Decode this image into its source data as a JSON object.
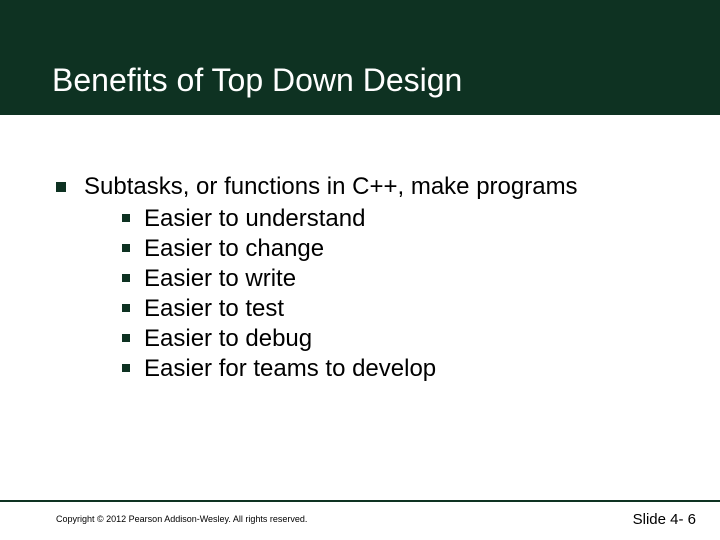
{
  "slide": {
    "title": "Benefits of Top Down Design",
    "main_bullet": "Subtasks, or functions in C++, make programs",
    "sub_bullets": [
      "Easier to understand",
      "Easier to change",
      "Easier to write",
      "Easier to test",
      "Easier to debug",
      "Easier for teams to develop"
    ],
    "copyright": "Copyright © 2012 Pearson Addison-Wesley. All rights reserved.",
    "slide_number": "Slide 4- 6"
  }
}
